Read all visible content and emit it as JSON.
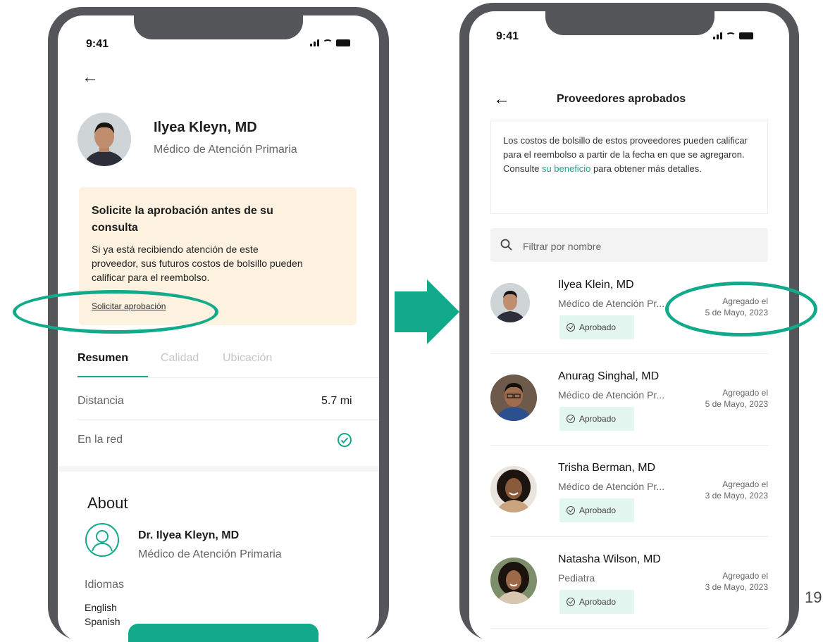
{
  "left_screen": {
    "status_time": "9:41",
    "doctor_name": "Ilyea Kleyn, MD",
    "doctor_specialty": "Médico de Atención Primaria",
    "banner_title": "Solicite la aprobación antes de su consulta",
    "banner_body": "Si ya está recibiendo atención de este proveedor, sus futuros costos de bolsillo pueden calificar para el reembolso.",
    "banner_link": "Solicitar aprobación",
    "tabs": [
      "Resumen",
      "Calidad",
      "Ubicación"
    ],
    "rows": [
      {
        "label": "Distancia",
        "value": "5.7 mi"
      },
      {
        "label": "En la red",
        "value": ""
      }
    ],
    "about_title": "About",
    "about_name": "Dr. Ilyea Kleyn, MD",
    "about_specialty": "Médico de Atención Primaria",
    "languages_title": "Idiomas",
    "languages": [
      "English",
      "Spanish"
    ]
  },
  "right_screen": {
    "status_time": "9:41",
    "title": "Proveedores aprobados",
    "info_text_before": "Los costos de bolsillo de estos proveedores pueden calificar para el reembolso a partir de la fecha en que se agregaron. Consulte",
    "info_link": "su beneficio",
    "info_text_after": "para obtener más detalles.",
    "search_placeholder": "Filtrar por nombre",
    "providers": [
      {
        "name": "Ilyea Klein, MD",
        "specialty": "Médico de Atención Pr...",
        "badge": "Aprobado",
        "added_label": "Agregado el",
        "added_date": "5 de Mayo, 2023"
      },
      {
        "name": "Anurag Singhal, MD",
        "specialty": "Médico de Atención Pr...",
        "badge": "Aprobado",
        "added_label": "Agregado el",
        "added_date": "5 de Mayo, 2023"
      },
      {
        "name": "Trisha Berman, MD",
        "specialty": "Médico de Atención Pr...",
        "badge": "Aprobado",
        "added_label": "Agregado el",
        "added_date": "3 de Mayo, 2023"
      },
      {
        "name": "Natasha Wilson, MD",
        "specialty": "Pediatra",
        "badge": "Aprobado",
        "added_label": "Agregado el",
        "added_date": "3 de Mayo, 2023"
      }
    ]
  },
  "page_number": "19",
  "colors": {
    "accent": "#13a98b",
    "banner_bg": "#fdf1df",
    "badge_bg": "#e4f6f0",
    "frame": "#55565a"
  }
}
